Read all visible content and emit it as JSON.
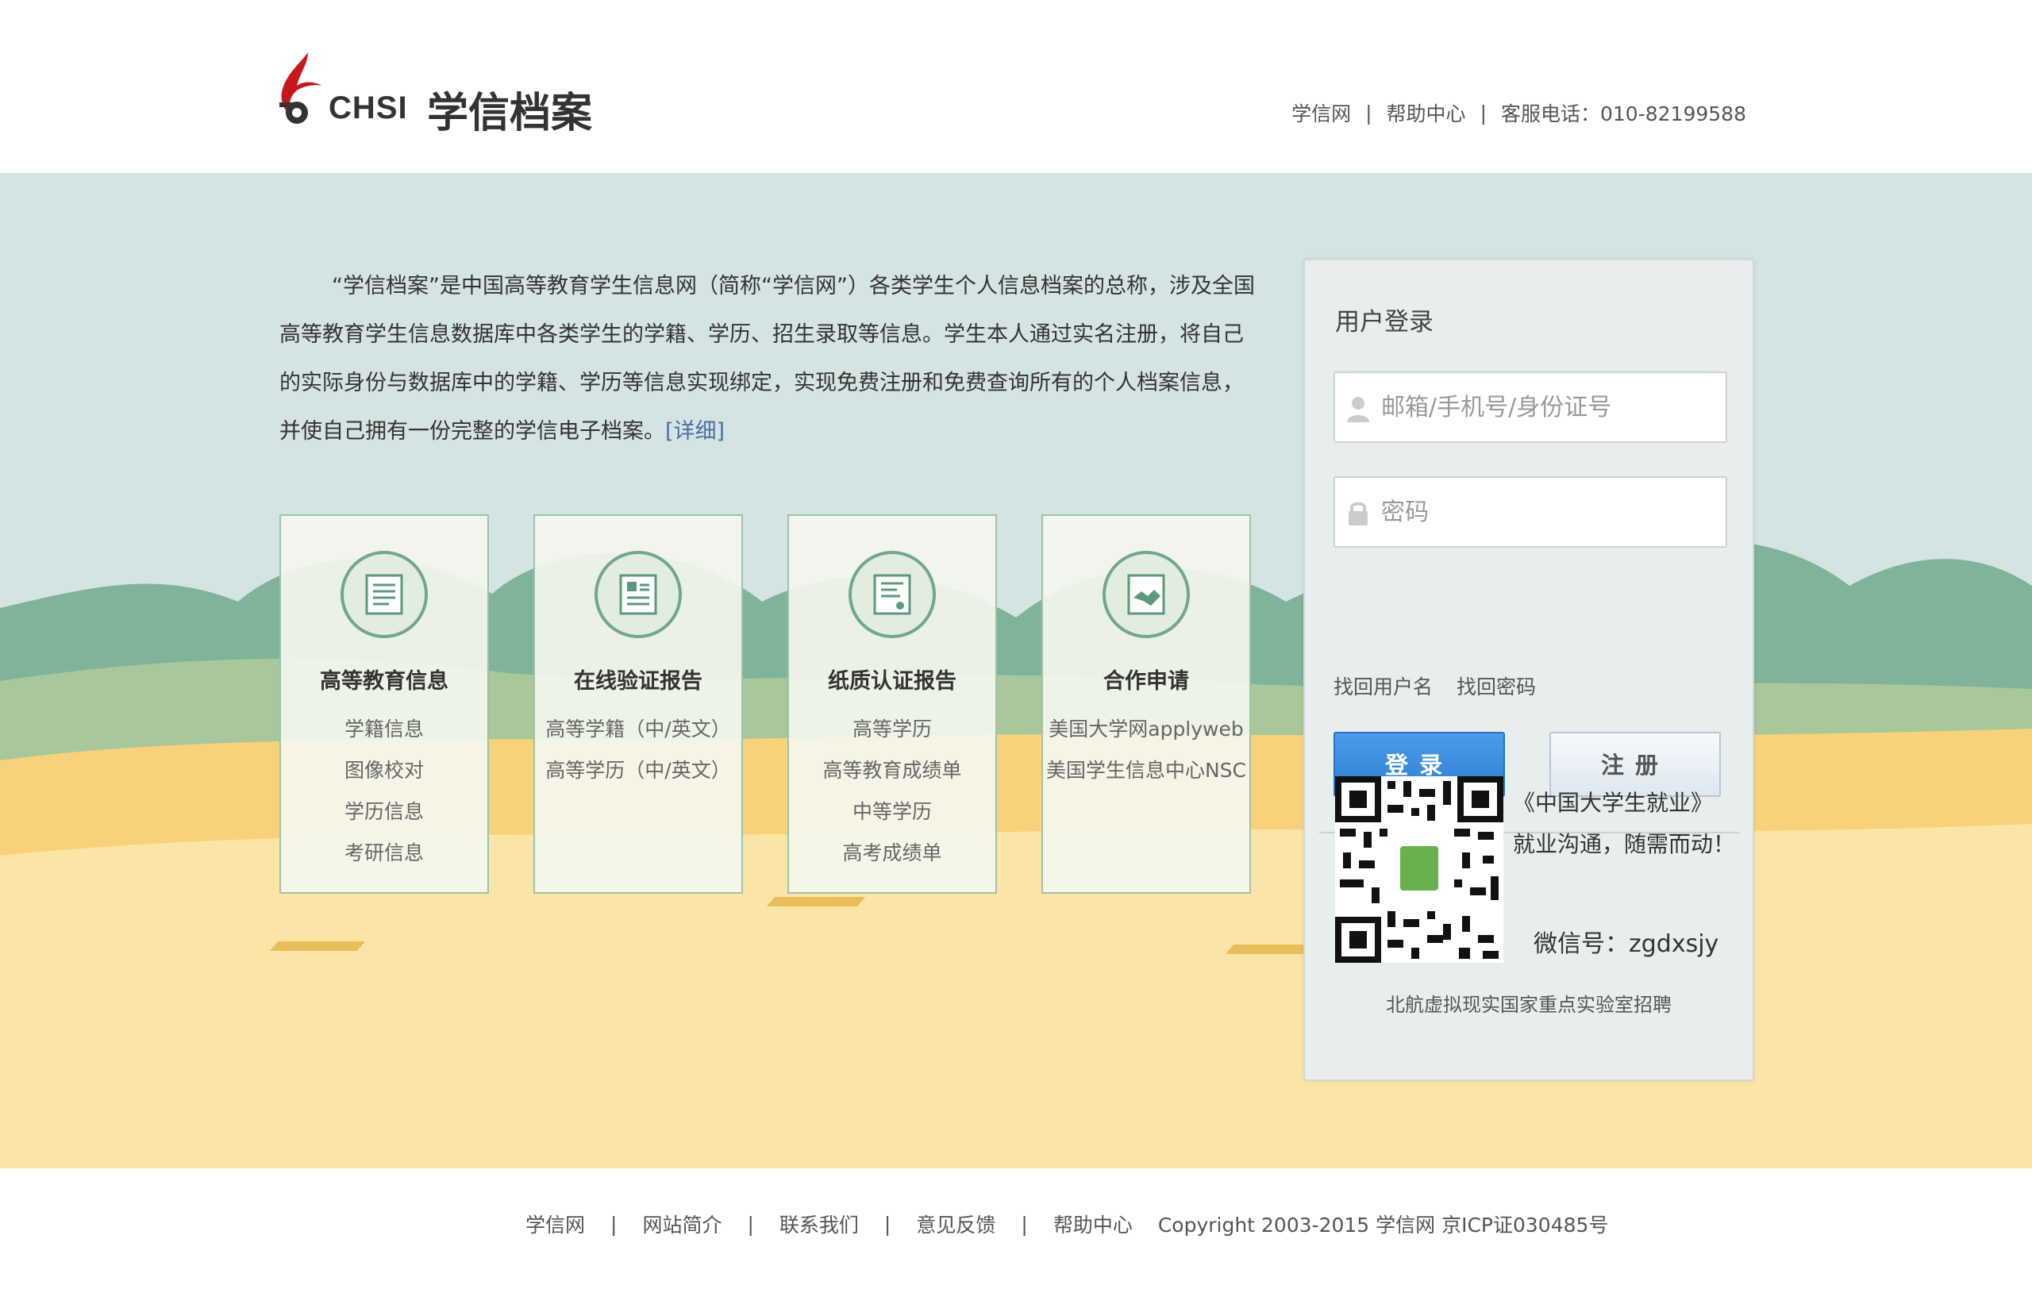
{
  "header": {
    "logo_abbr": "CHSI",
    "logo_title": "学信档案",
    "links": [
      "学信网",
      "帮助中心"
    ],
    "hotline": "客服电话：010-82199588"
  },
  "intro": {
    "text": "“学信档案”是中国高等教育学生信息网（简称“学信网”）各类学生个人信息档案的总称，涉及全国高等教育学生信息数据库中各类学生的学籍、学历、招生录取等信息。学生本人通过实名注册，将自己的实际身份与数据库中的学籍、学历等信息实现绑定，实现免费注册和免费查询所有的个人档案信息，并使自己拥有一份完整的学信电子档案。",
    "detail_link": "[详细]"
  },
  "cards": [
    {
      "icon": "document-icon",
      "title": "高等教育信息",
      "items": [
        "学籍信息",
        "图像校对",
        "学历信息",
        "考研信息"
      ]
    },
    {
      "icon": "report-icon",
      "title": "在线验证报告",
      "items": [
        "高等学籍（中/英文）",
        "高等学历（中/英文）"
      ]
    },
    {
      "icon": "certificate-icon",
      "title": "纸质认证报告",
      "items": [
        "高等学历",
        "高等教育成绩单",
        "中等学历",
        "高考成绩单"
      ]
    },
    {
      "icon": "handshake-icon",
      "title": "合作申请",
      "items": [
        "美国大学网applyweb",
        "美国学生信息中心NSC"
      ]
    }
  ],
  "login": {
    "title": "用户登录",
    "username_placeholder": "邮箱/手机号/身份证号",
    "password_placeholder": "密码",
    "find_username": "找回用户名",
    "find_password": "找回密码",
    "login_button": "登录",
    "register_button": "注册",
    "promo_line1": "《中国大学生就业》",
    "promo_line2": "就业沟通，随需而动！",
    "wechat": "微信号：zgdxsjy",
    "recruit": "北航虚拟现实国家重点实验室招聘"
  },
  "footer": {
    "links": [
      "学信网",
      "网站简介",
      "联系我们",
      "意见反馈",
      "帮助中心"
    ],
    "copyright": "Copyright 2003-2015 学信网 京ICP证030485号"
  },
  "colors": {
    "sky": "#d4e4e2",
    "hills": "#7fb49a",
    "sand": "#fbe5a6",
    "primary_button": "#2d7fd4",
    "card_border": "#9fc2a8"
  }
}
